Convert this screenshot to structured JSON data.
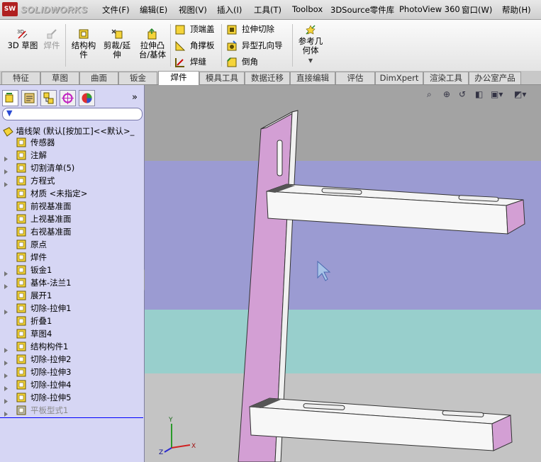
{
  "titlebar": {
    "logo_text": "SW",
    "brand": "SOLIDWORKS",
    "menus": [
      "文件(F)",
      "编辑(E)",
      "视图(V)",
      "插入(I)",
      "工具(T)",
      "Toolbox",
      "3DSource零件库",
      "PhotoView 360",
      "窗口(W)",
      "帮助(H)"
    ]
  },
  "ribbon": {
    "sketch3d": "3D 草图",
    "weldment": "焊件",
    "structural_member": [
      "结构构",
      "件"
    ],
    "trim_extend": [
      "剪裁/延",
      "伸"
    ],
    "boss_extrude": [
      "拉伸凸",
      "台/基体"
    ],
    "end_cap": "顶端盖",
    "gusset": "角撑板",
    "weld_bead": "焊缝",
    "extruded_cut": "拉伸切除",
    "hole_wizard": "异型孔向导",
    "chamfer": "倒角",
    "ref_geometry": [
      "参考几",
      "何体"
    ]
  },
  "tabs": [
    "特征",
    "草图",
    "曲面",
    "钣金",
    "焊件",
    "模具工具",
    "数据迁移",
    "直接编辑",
    "评估",
    "DimXpert",
    "渲染工具",
    "办公室产品"
  ],
  "active_tab": "焊件",
  "tree": {
    "root": "墙线架 (默认[按加工]<<默认>_",
    "items": [
      {
        "label": "传感器",
        "icon": "sensor-icon"
      },
      {
        "label": "注解",
        "icon": "annotation-icon"
      },
      {
        "label": "切割清单(5)",
        "icon": "cut-list-icon"
      },
      {
        "label": "方程式",
        "icon": "equation-icon"
      },
      {
        "label": "材质 <未指定>",
        "icon": "material-icon"
      },
      {
        "label": "前视基准面",
        "icon": "plane-icon"
      },
      {
        "label": "上视基准面",
        "icon": "plane-icon"
      },
      {
        "label": "右视基准面",
        "icon": "plane-icon"
      },
      {
        "label": "原点",
        "icon": "origin-icon"
      },
      {
        "label": "焊件",
        "icon": "weldment-icon"
      },
      {
        "label": "钣金1",
        "icon": "sheet-metal-icon"
      },
      {
        "label": "基体-法兰1",
        "icon": "base-flange-icon"
      },
      {
        "label": "展开1",
        "icon": "unfold-icon"
      },
      {
        "label": "切除-拉伸1",
        "icon": "cut-extrude-icon"
      },
      {
        "label": "折叠1",
        "icon": "fold-icon"
      },
      {
        "label": "草图4",
        "icon": "sketch-icon"
      },
      {
        "label": "结构构件1",
        "icon": "structural-member-icon"
      },
      {
        "label": "切除-拉伸2",
        "icon": "cut-extrude-icon"
      },
      {
        "label": "切除-拉伸3",
        "icon": "cut-extrude-icon"
      },
      {
        "label": "切除-拉伸4",
        "icon": "cut-extrude-icon"
      },
      {
        "label": "切除-拉伸5",
        "icon": "cut-extrude-icon"
      },
      {
        "label": "平板型式1",
        "icon": "flat-pattern-icon"
      }
    ]
  },
  "triad": {
    "x": "X",
    "y": "Y",
    "z": "Z"
  },
  "colors": {
    "panel_bg": "#d6d6f4",
    "view_top": "#a2a2a2",
    "view_mid1": "#9b9bd2",
    "view_mid2": "#98cfcc",
    "view_bottom": "#c4c4c4",
    "part_face": "#f4f4f4",
    "part_edge_face": "#d39fd4"
  }
}
